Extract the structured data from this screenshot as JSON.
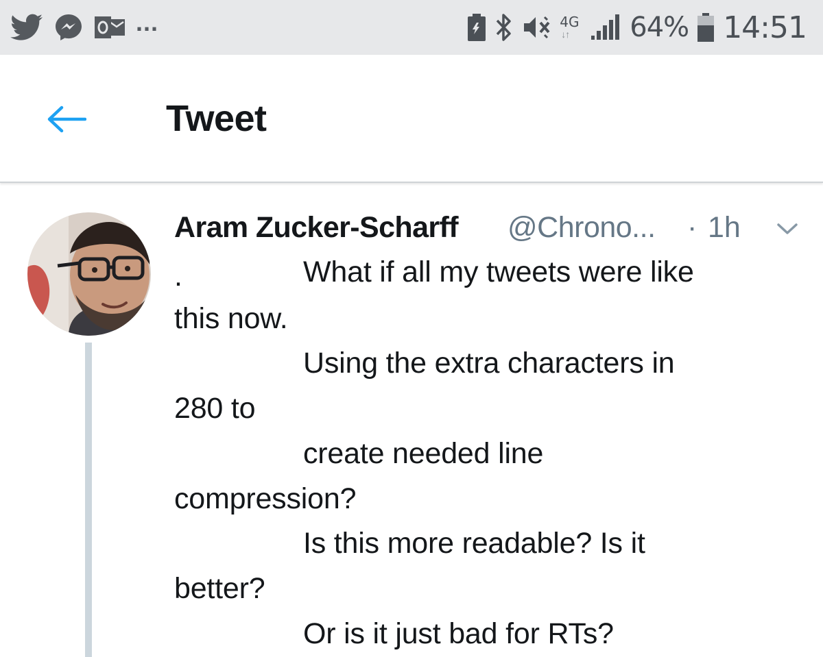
{
  "status_bar": {
    "left_icons": [
      "twitter-icon",
      "messenger-icon",
      "outlook-icon"
    ],
    "more_indicator": "...",
    "right_icons": [
      "data-saver-icon",
      "bluetooth-icon",
      "vibrate-mute-icon",
      "network-4g-icon",
      "signal-icon",
      "battery-icon"
    ],
    "network_type": "4G",
    "network_arrows": "↓↑",
    "battery_percent": "64%",
    "battery_level": 0.64,
    "time": "14:51"
  },
  "header": {
    "title": "Tweet",
    "back_icon": "back-arrow-icon",
    "accent_color": "#1da1f2"
  },
  "tweet": {
    "author_name": "Aram Zucker-Scharff",
    "author_handle": "@Chrono...",
    "separator": "·",
    "time_ago": "1h",
    "menu_icon": "chevron-down-icon",
    "avatar_icon": "avatar",
    "body_lines": [
      ".",
      "What if all my tweets were like",
      "this now.",
      "Using the extra characters in",
      "280 to",
      "create needed line",
      "compression?",
      "Is this more readable? Is it",
      "better?",
      "Or is it just bad for RTs?"
    ]
  },
  "colors": {
    "status_bar_bg": "#e7e8ea",
    "text_primary": "#14171a",
    "text_secondary": "#657786",
    "thread_line": "#ccd6dd"
  }
}
